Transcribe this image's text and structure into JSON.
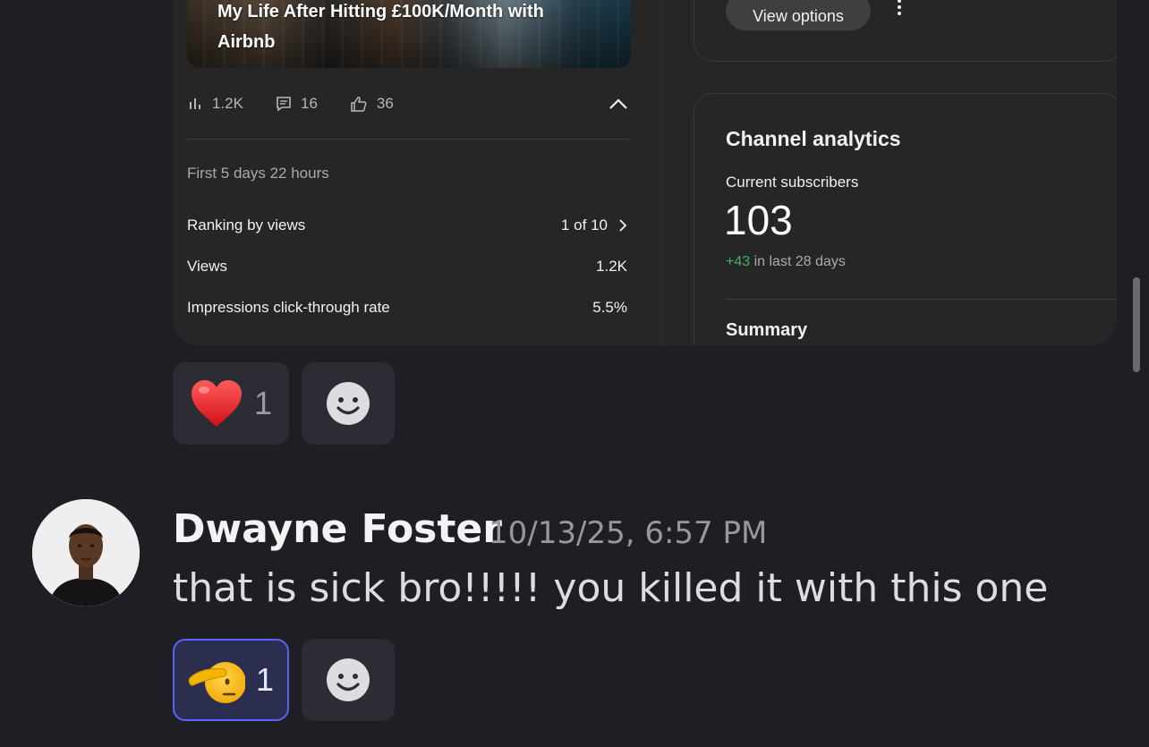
{
  "embed": {
    "video_title": "My Life After Hitting £100K/Month with Airbnb",
    "stats": {
      "views": "1.2K",
      "comments": "16",
      "likes": "36"
    },
    "period": "First 5 days 22 hours",
    "metrics": [
      {
        "label": "Ranking by views",
        "value": "1 of 10"
      },
      {
        "label": "Views",
        "value": "1.2K"
      },
      {
        "label": "Impressions click-through rate",
        "value": "5.5%"
      }
    ],
    "view_options_label": "View options",
    "channel_analytics": {
      "title": "Channel analytics",
      "subscribers_label": "Current subscribers",
      "subscribers_count": "103",
      "delta": "+43",
      "delta_suffix": " in last 28 days",
      "summary_label": "Summary"
    }
  },
  "reactions_first": [
    {
      "emoji": "heart",
      "count": "1"
    },
    {
      "emoji": "add-reaction"
    }
  ],
  "message": {
    "author": "Dwayne Foster",
    "timestamp": "10/13/25, 6:57 PM",
    "text": "that is sick bro!!!!! you killed it with this one"
  },
  "reactions_second": [
    {
      "emoji": "saluting-face",
      "count": "1",
      "active": true
    },
    {
      "emoji": "add-reaction"
    }
  ],
  "colors": {
    "background": "#1e1f24",
    "reaction_bg": "#2c2d34",
    "reaction_active_border": "#5865f2",
    "positive_delta": "#3fb45c"
  }
}
